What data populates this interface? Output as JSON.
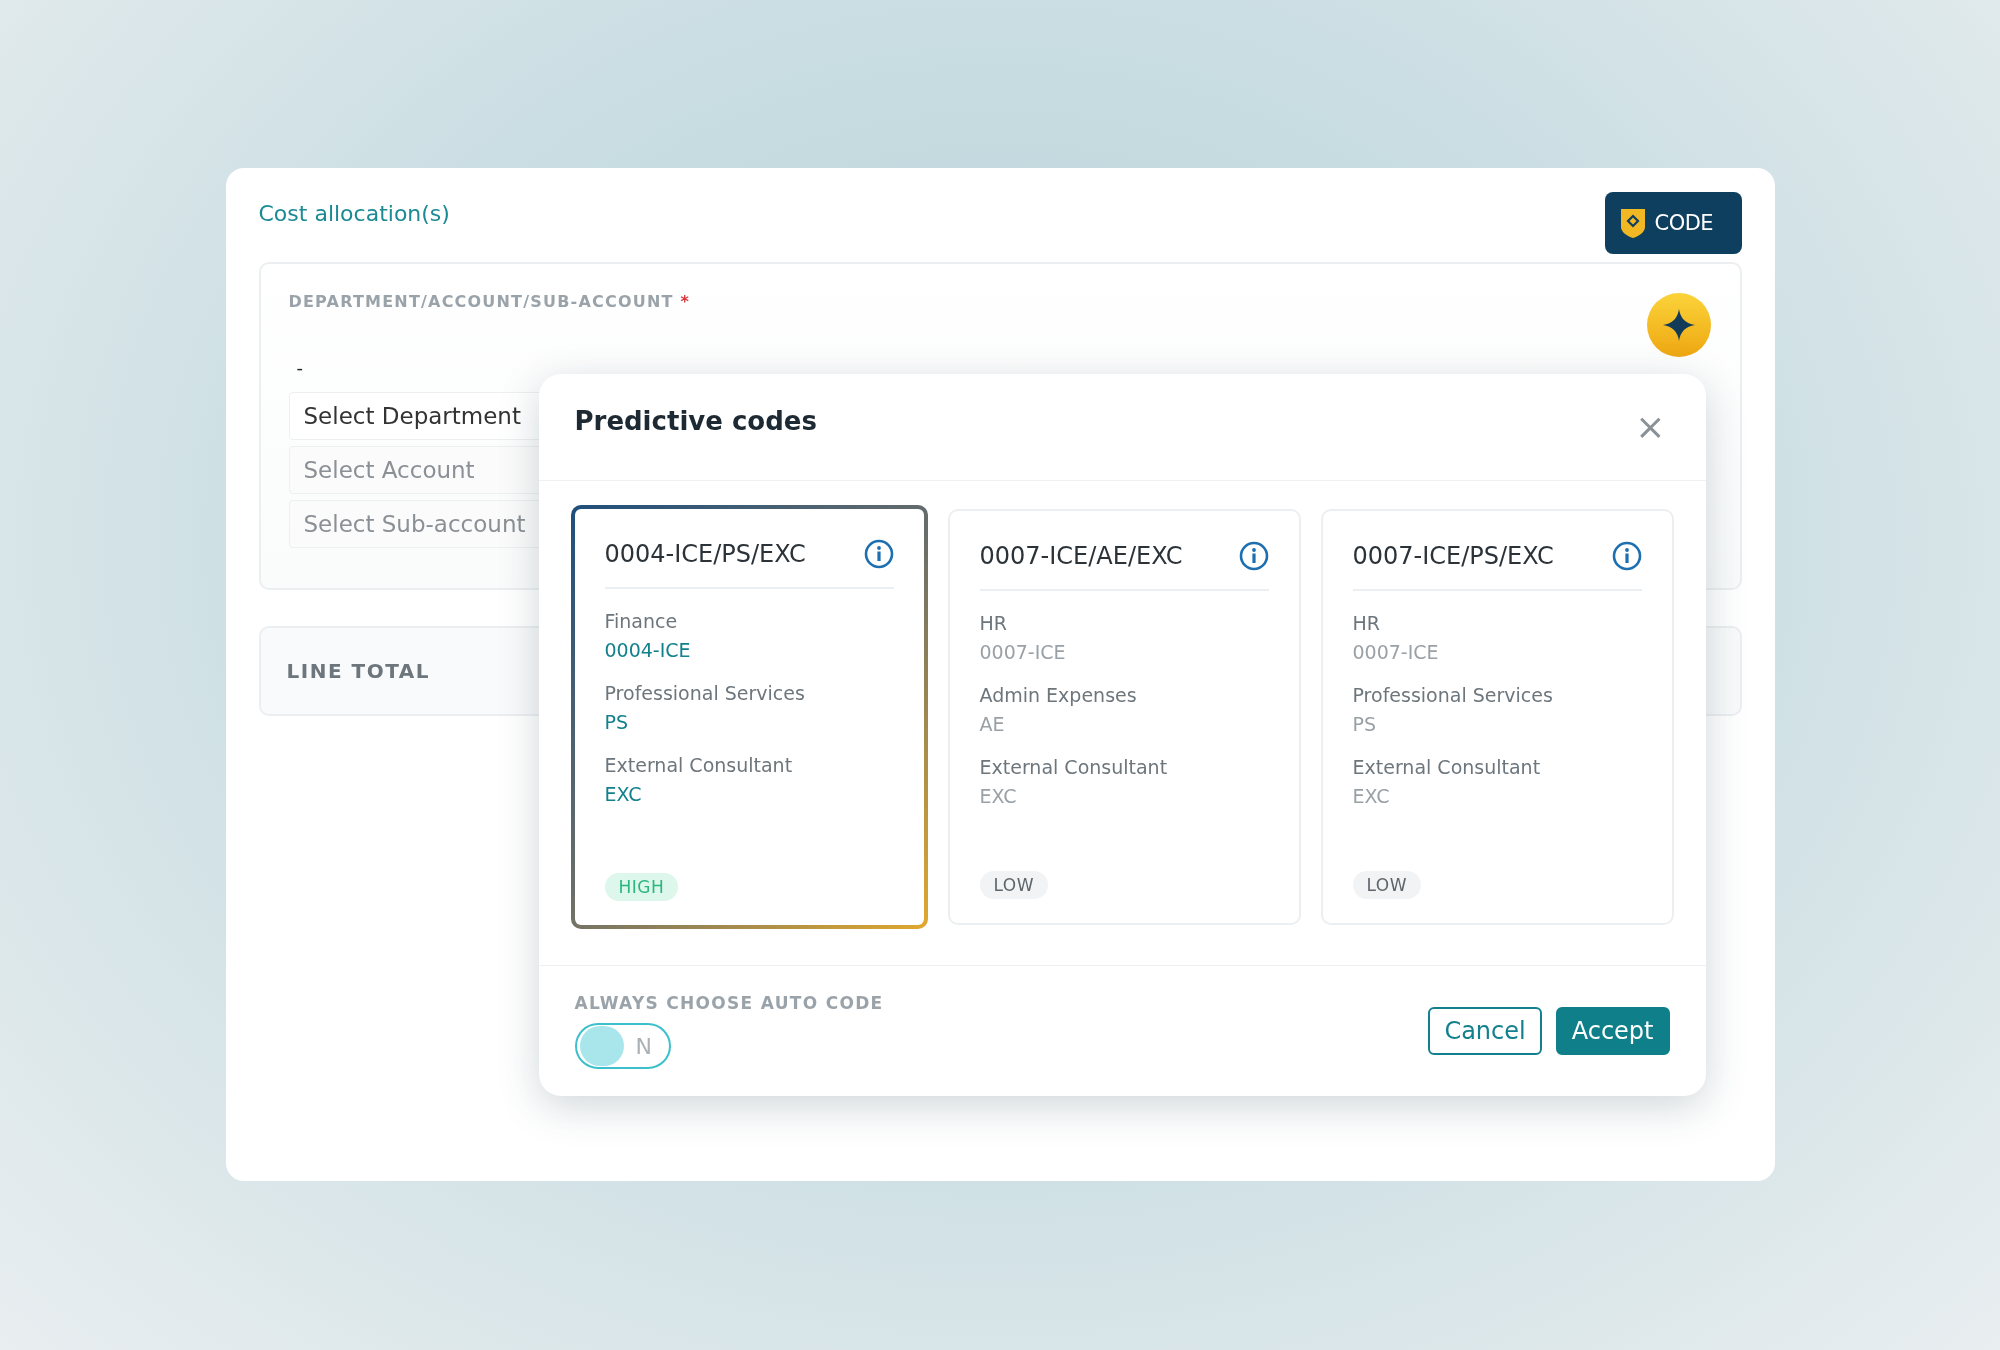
{
  "section": {
    "title": "Cost allocation(s)",
    "code_button": "CODE"
  },
  "account_field": {
    "label": "DEPARTMENT/ACCOUNT/SUB-ACCOUNT",
    "required_mark": "*",
    "value": "-",
    "selects": [
      {
        "placeholder": "Select Department",
        "disabled": false
      },
      {
        "placeholder": "Select Account",
        "disabled": true
      },
      {
        "placeholder": "Select Sub-account",
        "disabled": true
      }
    ]
  },
  "line_total": {
    "label": "LINE TOTAL"
  },
  "modal": {
    "title": "Predictive codes",
    "close": "×",
    "cards": [
      {
        "code": "0004-ICE/PS/EXC",
        "selected": true,
        "rows": [
          {
            "name": "Finance",
            "code": "0004-ICE"
          },
          {
            "name": "Professional Services",
            "code": "PS"
          },
          {
            "name": "External Consultant",
            "code": "EXC"
          }
        ],
        "confidence": {
          "label": "HIGH",
          "kind": "high"
        }
      },
      {
        "code": "0007-ICE/AE/EXC",
        "selected": false,
        "rows": [
          {
            "name": "HR",
            "code": "0007-ICE"
          },
          {
            "name": "Admin Expenses",
            "code": "AE"
          },
          {
            "name": "External Consultant",
            "code": "EXC"
          }
        ],
        "confidence": {
          "label": "LOW",
          "kind": "low"
        }
      },
      {
        "code": "0007-ICE/PS/EXC",
        "selected": false,
        "rows": [
          {
            "name": "HR",
            "code": "0007-ICE"
          },
          {
            "name": "Professional Services",
            "code": "PS"
          },
          {
            "name": "External Consultant",
            "code": "EXC"
          }
        ],
        "confidence": {
          "label": "LOW",
          "kind": "low"
        }
      }
    ],
    "auto_code": {
      "label": "ALWAYS CHOOSE AUTO CODE",
      "on": false,
      "state_text": "N"
    },
    "buttons": [
      {
        "label": "Cancel",
        "kind": "secondary"
      },
      {
        "label": "Accept",
        "kind": "primary"
      }
    ]
  }
}
